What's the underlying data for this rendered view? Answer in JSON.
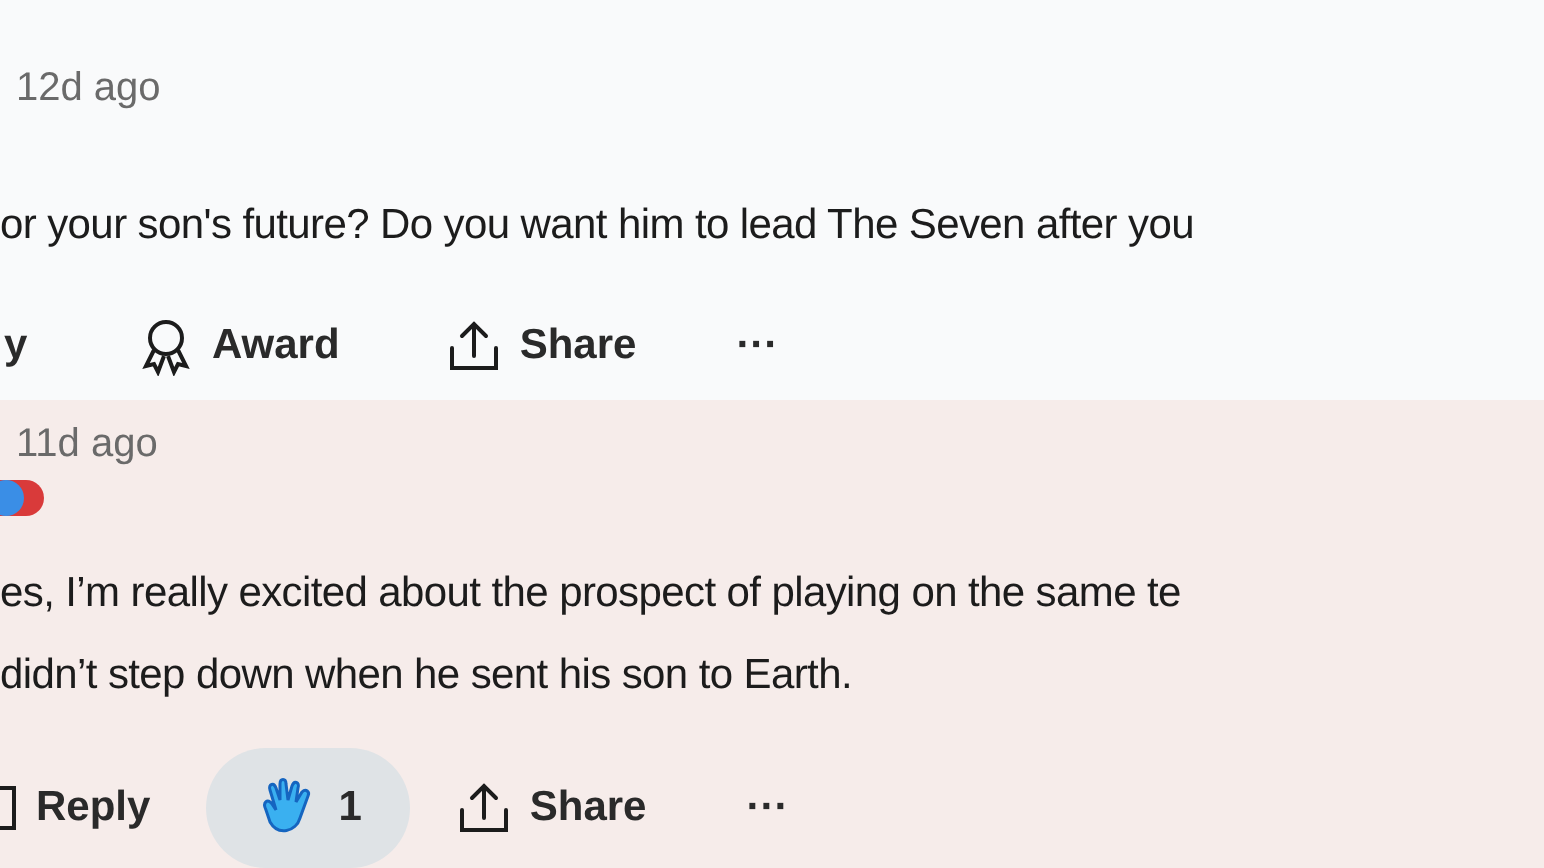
{
  "comments": [
    {
      "time": "12d ago",
      "badge": false,
      "lines": [
        "or your son's future? Do you want him to lead The Seven after you"
      ],
      "actions": [
        {
          "kind": "reply",
          "label": "y"
        },
        {
          "kind": "award",
          "label": "Award"
        },
        {
          "kind": "share",
          "label": "Share"
        },
        {
          "kind": "more",
          "label": "···"
        }
      ]
    },
    {
      "time": "11d ago",
      "badge": true,
      "lines": [
        "es, I’m really excited about the prospect of playing on the same te",
        "didn’t step down when he sent his son to Earth."
      ],
      "actions": [
        {
          "kind": "reply",
          "label": "Reply"
        },
        {
          "kind": "awarded",
          "label": "1"
        },
        {
          "kind": "share",
          "label": "Share"
        },
        {
          "kind": "more",
          "label": "···"
        }
      ]
    }
  ]
}
